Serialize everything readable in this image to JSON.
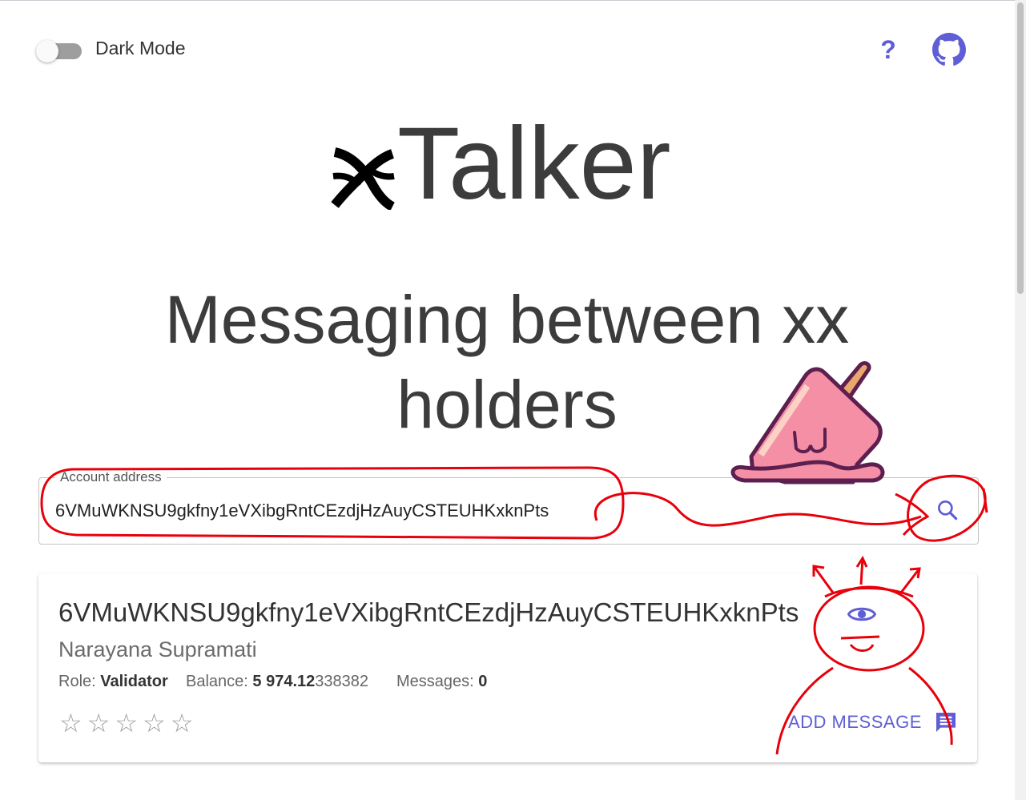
{
  "header": {
    "dark_mode_label": "Dark Mode",
    "help_label": "?",
    "github_icon": "github-icon"
  },
  "logo": {
    "text": "Talker",
    "mark_icon": "xx-network-logo"
  },
  "hero": {
    "line1": "Messaging between xx",
    "line2": "holders"
  },
  "search": {
    "label": "Account address",
    "value": "6VMuWKNSU9gkfny1eVXibgRntCEzdjHzAuyCSTEUHKxknPts",
    "icon": "search-icon"
  },
  "result": {
    "address": "6VMuWKNSU9gkfny1eVXibgRntCEzdjHzAuyCSTEUHKxknPts",
    "name": "Narayana Supramati",
    "role_label": "Role:",
    "role_value": "Validator",
    "balance_label": "Balance:",
    "balance_bold": "5 974.12",
    "balance_rest": "338382",
    "messages_label": "Messages:",
    "messages_value": "0",
    "stars": "☆☆☆☆☆",
    "add_message_label": "ADD MESSAGE",
    "eye_icon": "eye-icon",
    "message_icon": "message-icon"
  },
  "colors": {
    "accent": "#5f5ed6",
    "annotation": "#e8000b",
    "sticker_pink": "#f58fa6",
    "sticker_outline": "#5c1f4f"
  }
}
